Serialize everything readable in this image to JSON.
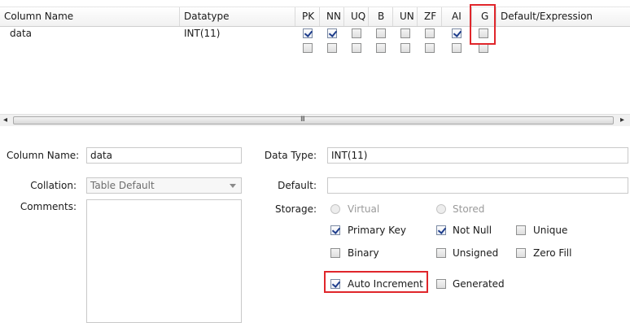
{
  "grid": {
    "headers": {
      "column_name": "Column Name",
      "datatype": "Datatype",
      "pk": "PK",
      "nn": "NN",
      "uq": "UQ",
      "b": "B",
      "un": "UN",
      "zf": "ZF",
      "ai": "AI",
      "g": "G",
      "default_expression": "Default/Expression"
    },
    "rows": [
      {
        "name": "data",
        "datatype": "INT(11)",
        "flags": {
          "pk": true,
          "nn": true,
          "uq": false,
          "b": false,
          "un": false,
          "zf": false,
          "ai": true,
          "g": false
        }
      },
      {
        "name": "",
        "datatype": "",
        "flags": {
          "pk": false,
          "nn": false,
          "uq": false,
          "b": false,
          "un": false,
          "zf": false,
          "ai": false,
          "g": false
        }
      }
    ],
    "scrollbar": {
      "left_arrow": "◂",
      "right_arrow": "▸",
      "grip": "III"
    }
  },
  "details": {
    "column_name_label": "Column Name:",
    "column_name_value": "data",
    "collation_label": "Collation:",
    "collation_value": "Table Default",
    "comments_label": "Comments:",
    "comments_value": "",
    "data_type_label": "Data Type:",
    "data_type_value": "INT(11)",
    "default_label": "Default:",
    "default_value": "",
    "storage_label": "Storage:",
    "storage_options": {
      "virtual": "Virtual",
      "stored": "Stored"
    },
    "checkboxes": {
      "primary_key": {
        "label": "Primary Key",
        "checked": true
      },
      "not_null": {
        "label": "Not Null",
        "checked": true
      },
      "unique": {
        "label": "Unique",
        "checked": false
      },
      "binary": {
        "label": "Binary",
        "checked": false
      },
      "unsigned": {
        "label": "Unsigned",
        "checked": false
      },
      "zero_fill": {
        "label": "Zero Fill",
        "checked": false
      },
      "auto_increment": {
        "label": "Auto Increment",
        "checked": true
      },
      "generated": {
        "label": "Generated",
        "checked": false
      }
    }
  },
  "colors": {
    "highlight": "#e0262b",
    "check": "#1e3d8c"
  }
}
